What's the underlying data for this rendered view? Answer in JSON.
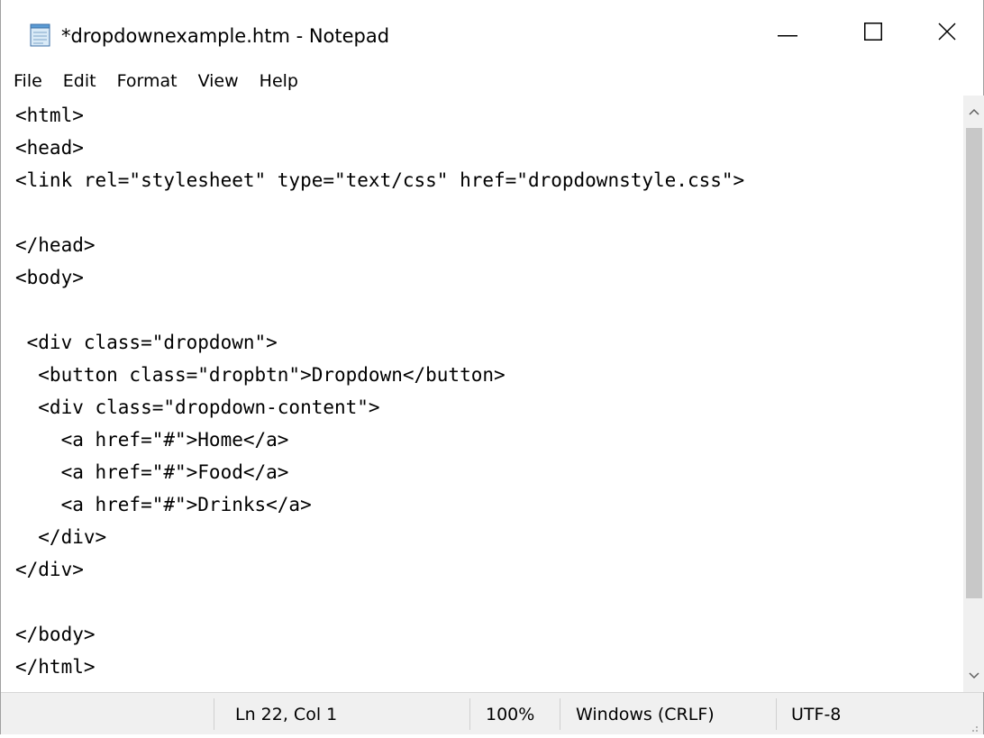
{
  "window": {
    "title": "*dropdownexample.htm - Notepad"
  },
  "menu": {
    "items": [
      "File",
      "Edit",
      "Format",
      "View",
      "Help"
    ]
  },
  "editor": {
    "lines": [
      "<html>",
      "<head>",
      "<link rel=\"stylesheet\" type=\"text/css\" href=\"dropdownstyle.css\">",
      "",
      "</head>",
      "<body>",
      "",
      " <div class=\"dropdown\">",
      "  <button class=\"dropbtn\">Dropdown</button>",
      "  <div class=\"dropdown-content\">",
      "    <a href=\"#\">Home</a>",
      "    <a href=\"#\">Food</a>",
      "    <a href=\"#\">Drinks</a>",
      "  </div>",
      "</div>",
      "",
      "</body>",
      "</html>"
    ]
  },
  "status": {
    "position": "Ln 22, Col 1",
    "zoom": "100%",
    "line_ending": "Windows (CRLF)",
    "encoding": "UTF-8"
  },
  "icons": {
    "app": "notepad-icon",
    "minimize": "minimize-icon",
    "maximize": "maximize-icon",
    "close": "close-icon",
    "scroll_up": "chevron-up-icon",
    "scroll_down": "chevron-down-icon"
  }
}
